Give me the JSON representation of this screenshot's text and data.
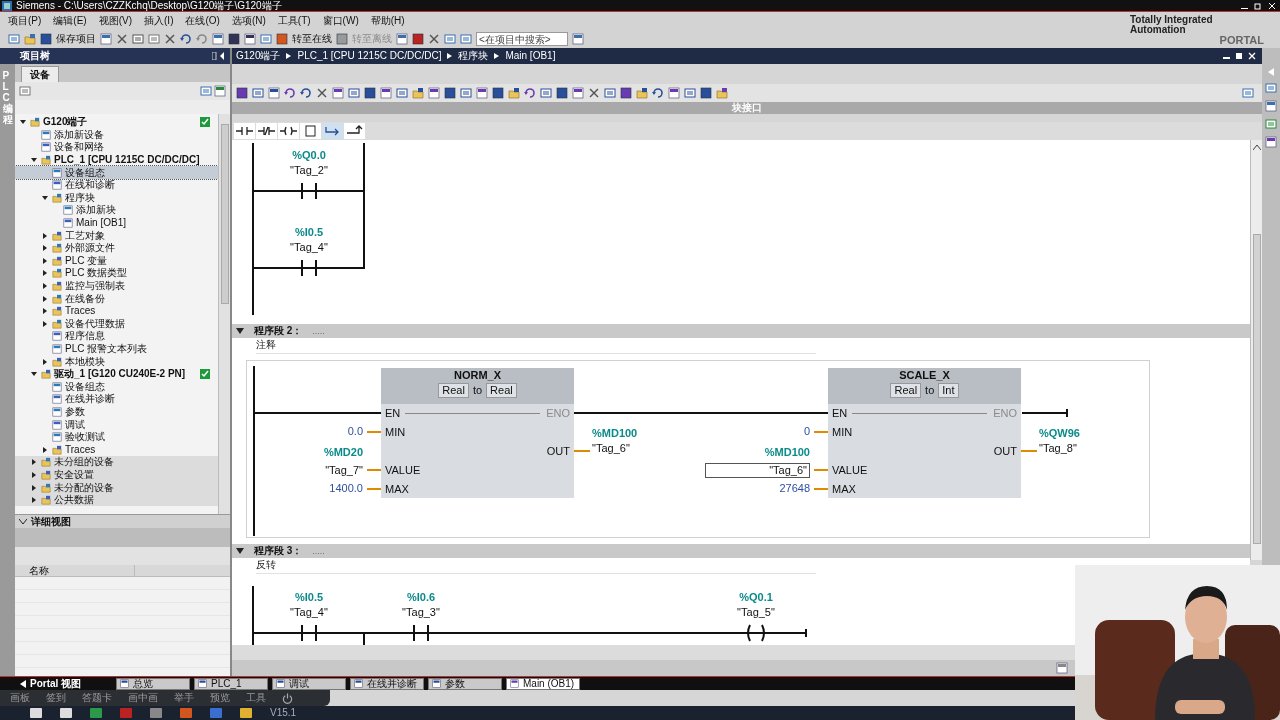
{
  "window": {
    "title": "Siemens  -  C:\\Users\\CZZKchq\\Desktop\\G120端子\\G120端子"
  },
  "menu": [
    "项目(P)",
    "编辑(E)",
    "视图(V)",
    "插入(I)",
    "在线(O)",
    "选项(N)",
    "工具(T)",
    "窗口(W)",
    "帮助(H)"
  ],
  "toolbar": {
    "save_label": "保存项目",
    "online_label": "转至在线",
    "offline_label": "转至离线",
    "search_placeholder": "<在项目中搜索>"
  },
  "brand": {
    "line1": "Totally Integrated Automation",
    "line2": "PORTAL"
  },
  "project_tree": {
    "title": "项目树",
    "side_tab": "PLC 编程",
    "tab": "设备",
    "items": [
      {
        "label": "G120端子",
        "expanded": true,
        "selected": false,
        "ok": true,
        "children": [
          {
            "label": "添加新设备",
            "selected": false,
            "ok": false
          },
          {
            "label": "设备和网络",
            "selected": false,
            "ok": false
          },
          {
            "label": "PLC_1 [CPU 1215C DC/DC/DC]",
            "expanded": true,
            "selected": false,
            "ok": false,
            "children": [
              {
                "label": "设备组态",
                "selected": true,
                "ok": false
              },
              {
                "label": "在线和诊断",
                "selected": false,
                "ok": false
              },
              {
                "label": "程序块",
                "expanded": true,
                "selected": false,
                "ok": false,
                "children": [
                  {
                    "label": "添加新块",
                    "selected": false,
                    "ok": false
                  },
                  {
                    "label": "Main [OB1]",
                    "selected": false,
                    "ok": false
                  }
                ]
              },
              {
                "label": "工艺对象",
                "expanded": false,
                "selected": false,
                "ok": false
              },
              {
                "label": "外部源文件",
                "expanded": false,
                "selected": false,
                "ok": false
              },
              {
                "label": "PLC 变量",
                "expanded": false,
                "selected": false,
                "ok": false
              },
              {
                "label": "PLC 数据类型",
                "expanded": false,
                "selected": false,
                "ok": false
              },
              {
                "label": "监控与强制表",
                "expanded": false,
                "selected": false,
                "ok": false
              },
              {
                "label": "在线备份",
                "expanded": false,
                "selected": false,
                "ok": false
              },
              {
                "label": "Traces",
                "expanded": false,
                "selected": false,
                "ok": false
              },
              {
                "label": "设备代理数据",
                "expanded": false,
                "selected": false,
                "ok": false
              },
              {
                "label": "程序信息",
                "selected": false,
                "ok": false
              },
              {
                "label": "PLC 报警文本列表",
                "selected": false,
                "ok": false
              },
              {
                "label": "本地模块",
                "expanded": false,
                "selected": false,
                "ok": false
              }
            ]
          },
          {
            "label": "驱动_1 [G120 CU240E-2 PN]",
            "expanded": true,
            "selected": false,
            "ok": true,
            "children": [
              {
                "label": "设备组态",
                "selected": false,
                "ok": false
              },
              {
                "label": "在线并诊断",
                "selected": false,
                "ok": false
              },
              {
                "label": "参数",
                "selected": false,
                "ok": false
              },
              {
                "label": "调试",
                "selected": false,
                "ok": false
              },
              {
                "label": "验收测试",
                "selected": false,
                "ok": false
              },
              {
                "label": "Traces",
                "expanded": false,
                "selected": false,
                "ok": false
              }
            ]
          },
          {
            "label": "未分组的设备",
            "expanded": false,
            "selected": false,
            "ok": false
          },
          {
            "label": "安全设置",
            "expanded": false,
            "selected": false,
            "ok": false
          },
          {
            "label": "未分配的设备",
            "expanded": false,
            "selected": false,
            "ok": false
          },
          {
            "label": "公共数据",
            "expanded": false,
            "selected": false,
            "ok": false
          }
        ]
      }
    ],
    "detail_view": {
      "title": "详细视图",
      "column": "名称"
    }
  },
  "editor": {
    "breadcrumb": [
      "G120端子",
      "PLC_1 [CPU 1215C DC/DC/DC]",
      "程序块",
      "Main [OB1]"
    ],
    "interface_label": "块接口",
    "networks": [
      {
        "elements": [
          {
            "kind": "contact",
            "address": "%Q0.0",
            "tag": "\"Tag_2\""
          },
          {
            "kind": "contact",
            "address": "%I0.5",
            "tag": "\"Tag_4\""
          }
        ]
      },
      {
        "title": "程序段 2：",
        "ellipsis": ".....",
        "comment": "注释",
        "expanded": true,
        "elements": [
          {
            "kind": "box",
            "name": "NORM_X",
            "type_in": "Real",
            "to": "to",
            "type_out": "Real",
            "en": "EN",
            "eno": "ENO",
            "inputs": [
              {
                "pin": "MIN",
                "value": "0.0",
                "selected": false
              },
              {
                "pin": "VALUE",
                "address": "%MD20",
                "tag": "\"Tag_7\"",
                "selected": false
              },
              {
                "pin": "MAX",
                "value": "1400.0",
                "selected": false
              }
            ],
            "output": {
              "pin": "OUT",
              "address": "%MD100",
              "tag": "\"Tag_6\""
            }
          },
          {
            "kind": "box",
            "name": "SCALE_X",
            "type_in": "Real",
            "to": "to",
            "type_out": "Int",
            "en": "EN",
            "eno": "ENO",
            "inputs": [
              {
                "pin": "MIN",
                "value": "0",
                "selected": false
              },
              {
                "pin": "VALUE",
                "address": "%MD100",
                "tag": "\"Tag_6\"",
                "selected": true
              },
              {
                "pin": "MAX",
                "value": "27648",
                "selected": false
              }
            ],
            "output": {
              "pin": "OUT",
              "address": "%QW96",
              "tag": "\"Tag_8\""
            }
          }
        ]
      },
      {
        "title": "程序段 3：",
        "ellipsis": ".....",
        "comment": "反转",
        "expanded": true,
        "elements": [
          {
            "kind": "contact",
            "address": "%I0.5",
            "tag": "\"Tag_4\""
          },
          {
            "kind": "contact",
            "address": "%I0.6",
            "tag": "\"Tag_3\""
          },
          {
            "kind": "coil",
            "address": "%Q0.1",
            "tag": "\"Tag_5\""
          }
        ]
      }
    ]
  },
  "portal_view": "Portal 视图",
  "editor_tabs": [
    {
      "label": "总览",
      "selected": false
    },
    {
      "label": "PLC_1",
      "selected": false
    },
    {
      "label": "调试",
      "selected": false
    },
    {
      "label": "在线并诊断",
      "selected": false
    },
    {
      "label": "参数",
      "selected": false
    },
    {
      "label": "Main (OB1)",
      "selected": true
    }
  ],
  "overlay_toolbar": [
    "画板",
    "签到",
    "答题卡",
    "画中画",
    "举手",
    "预览",
    "工具"
  ],
  "taskbar": {
    "version": "V15.1"
  }
}
